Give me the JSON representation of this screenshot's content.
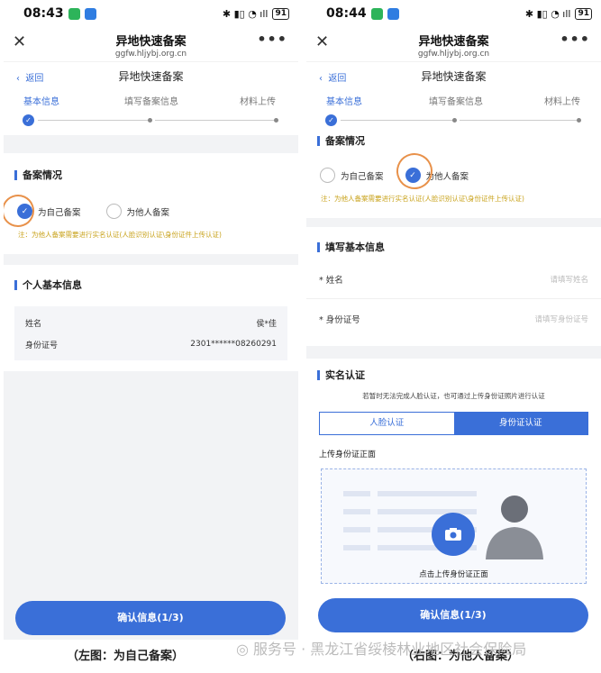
{
  "left": {
    "status": {
      "time": "08:43",
      "battery": "91"
    },
    "title": "异地快速备案",
    "url": "ggfw.hljybj.org.cn",
    "back": "返回",
    "nav_title": "异地快速备案",
    "steps": [
      "基本信息",
      "填写备案信息",
      "材料上传"
    ],
    "section1": "备案情况",
    "radio_self": "为自己备案",
    "radio_other": "为他人备案",
    "note": "注：为他人备案需要进行实名认证(人脸识别认证\\身份证件上传认证)",
    "section2": "个人基本信息",
    "name_label": "姓名",
    "name_value": "侯*佳",
    "id_label": "身份证号",
    "id_value": "2301******08260291",
    "confirm": "确认信息(1/3)"
  },
  "right": {
    "status": {
      "time": "08:44",
      "battery": "91"
    },
    "title": "异地快速备案",
    "url": "ggfw.hljybj.org.cn",
    "back": "返回",
    "nav_title": "异地快速备案",
    "steps": [
      "基本信息",
      "填写备案信息",
      "材料上传"
    ],
    "section1": "备案情况",
    "radio_self": "为自己备案",
    "radio_other": "为他人备案",
    "note": "注：为他人备案需要进行实名认证(人脸识别认证\\身份证件上传认证)",
    "section2": "填写基本信息",
    "name_label": "* 姓名",
    "name_placeholder": "请填写姓名",
    "id_label": "* 身份证号",
    "id_placeholder": "请填写身份证号",
    "section3": "实名认证",
    "realname_hint": "若暂时无法完成人脸认证，也可通过上传身份证照片进行认证",
    "tab_face": "人脸认证",
    "tab_id": "身份证认证",
    "upload_label": "上传身份证正面",
    "upload_hint": "点击上传身份证正面",
    "confirm": "确认信息(1/3)"
  },
  "captions": {
    "left": "（左图：为自己备案）",
    "right": "（右图：为他人备案）"
  },
  "watermark": "服务号 · 黑龙江省绥棱林业地区社会保险局",
  "colors": {
    "accent": "#3a6fd8",
    "note": "#c8a21a",
    "highlight": "#e8914a"
  }
}
